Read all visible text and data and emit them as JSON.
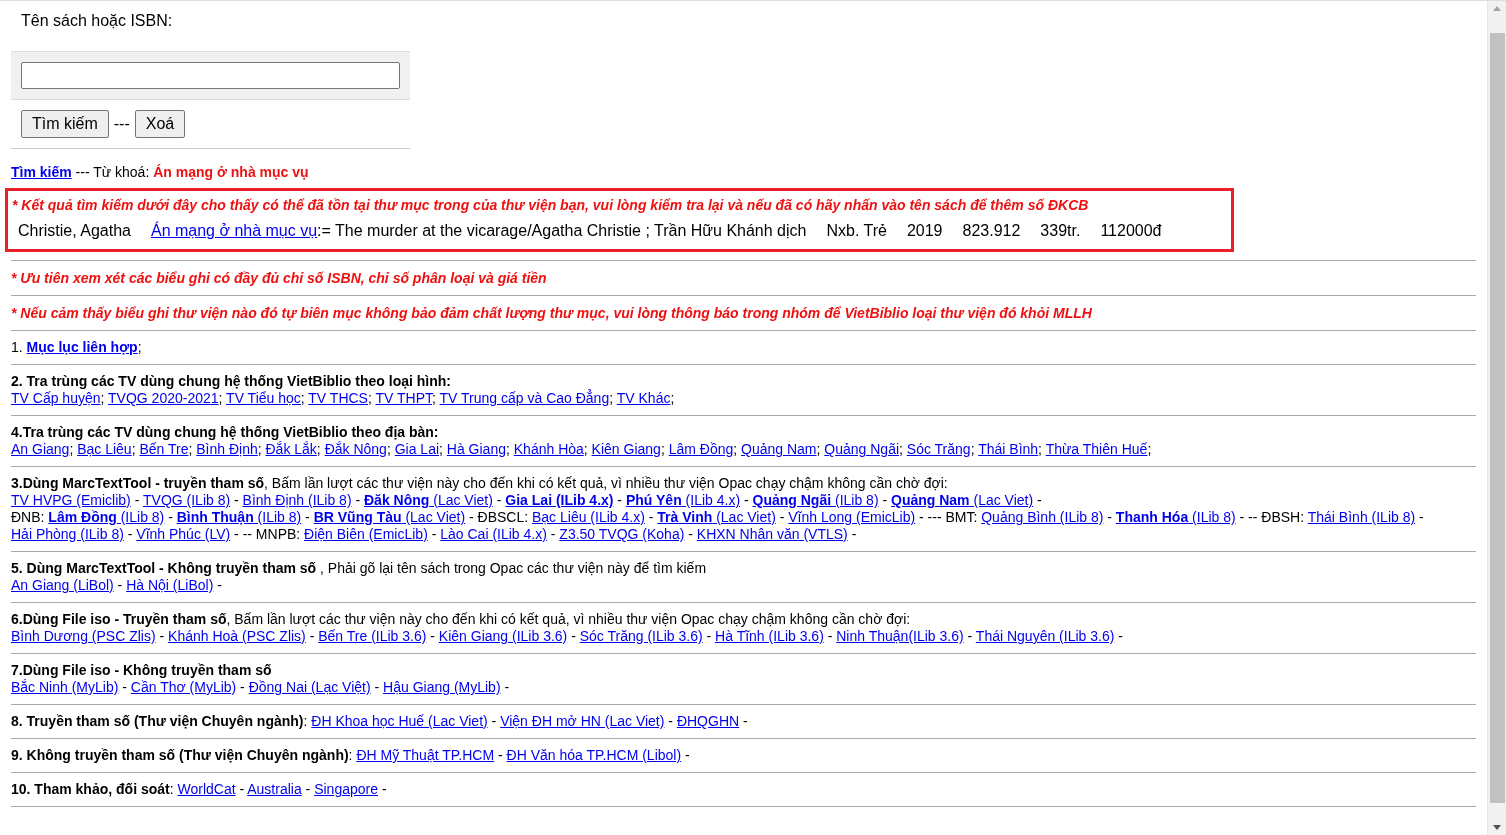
{
  "search_form": {
    "label": "Tên sách hoặc ISBN:",
    "search_button": "Tìm kiếm",
    "divider": "---",
    "clear_button": "Xoá"
  },
  "query": {
    "link": "Tìm kiếm",
    "label": " --- Từ khoá: ",
    "keyword": "Án mạng ở nhà mục vụ"
  },
  "result_box": {
    "notice": "* Kết quả tìm kiếm dưới đây cho thấy có thể đã tồn tại thư mục trong của thư viện bạn, vui lòng kiểm tra lại và nếu đã có hãy nhấn vào tên sách để thêm số ĐKCB",
    "record": {
      "author": "Christie, Agatha",
      "title_link": "Án mạng ở nhà mục vụ",
      "title_rest": ":= The murder at the vicarage/Agatha Christie ; Trần Hữu Khánh dịch",
      "publisher": "Nxb. Trẻ",
      "year": "2019",
      "class_number": "823.912",
      "pages": "339tr.",
      "price": "112000đ"
    }
  },
  "notes": [
    "* Ưu tiên xem xét các biểu ghi có đầy đủ chỉ số ISBN, chỉ số phân loại và giá tiền",
    "* Nếu cảm thấy biểu ghi thư viện nào đó tự biên mục không bảo đảm chất lượng thư mục, vui lòng thông báo trong nhóm để VietBiblio loại thư viện đó khỏi MLLH"
  ],
  "sections": [
    {
      "items": [
        {
          "kind": "text",
          "text": "1. "
        },
        {
          "kind": "link",
          "text": "**Mục lục liên hợp**",
          "after": ";"
        }
      ]
    },
    {
      "items": [
        {
          "kind": "bold",
          "text": "2. Tra trùng các TV dùng chung hệ thống VietBiblio theo loại hình:"
        },
        {
          "kind": "break"
        },
        {
          "kind": "link",
          "text": "TV Cấp huyện",
          "after": "; "
        },
        {
          "kind": "link",
          "text": "TVQG 2020-2021",
          "after": "; "
        },
        {
          "kind": "link",
          "text": "TV Tiểu học",
          "after": "; "
        },
        {
          "kind": "link",
          "text": "TV THCS",
          "after": "; "
        },
        {
          "kind": "link",
          "text": "TV THPT",
          "after": "; "
        },
        {
          "kind": "link",
          "text": "TV Trung cấp và Cao Đẳng",
          "after": "; "
        },
        {
          "kind": "link",
          "text": "TV Khác",
          "after": ";"
        }
      ]
    },
    {
      "items": [
        {
          "kind": "bold",
          "text": "4.Tra trùng các TV dùng chung hệ thống VietBiblio theo địa bàn:"
        },
        {
          "kind": "break"
        },
        {
          "kind": "link",
          "text": "An Giang",
          "after": "; "
        },
        {
          "kind": "link",
          "text": "Bạc Liêu",
          "after": "; "
        },
        {
          "kind": "link",
          "text": "Bến Tre",
          "after": "; "
        },
        {
          "kind": "link",
          "text": "Bình Định",
          "after": "; "
        },
        {
          "kind": "link",
          "text": "Đắk Lắk",
          "after": "; "
        },
        {
          "kind": "link",
          "text": "Đắk Nông",
          "after": "; "
        },
        {
          "kind": "link",
          "text": "Gia Lai",
          "after": "; "
        },
        {
          "kind": "link",
          "text": "Hà Giang",
          "after": "; "
        },
        {
          "kind": "link",
          "text": "Khánh Hòa",
          "after": "; "
        },
        {
          "kind": "link",
          "text": "Kiên Giang",
          "after": "; "
        },
        {
          "kind": "link",
          "text": "Lâm Đồng",
          "after": "; "
        },
        {
          "kind": "link",
          "text": "Quảng Nam",
          "after": "; "
        },
        {
          "kind": "link",
          "text": "Quảng Ngãi",
          "after": "; "
        },
        {
          "kind": "link",
          "text": "Sóc Trăng",
          "after": "; "
        },
        {
          "kind": "link",
          "text": "Thái Bình",
          "after": "; "
        },
        {
          "kind": "link",
          "text": "Thừa Thiên Huế",
          "after": ";"
        }
      ]
    },
    {
      "items": [
        {
          "kind": "text",
          "text": "**3.Dùng MarcTextTool - truyền tham số**, Bấm lần lượt các thư viện này cho đến khi có kết quả, vì nhiều thư viện Opac chạy chậm không cần chờ đợi:"
        },
        {
          "kind": "break"
        },
        {
          "kind": "link",
          "text": "TV HVPG (Emiclib)",
          "after": " - "
        },
        {
          "kind": "link",
          "text": "TVQG (ILib 8)",
          "after": " - "
        },
        {
          "kind": "link",
          "text": "Bình Định (ILib 8)",
          "after": " - "
        },
        {
          "kind": "link",
          "text": "**Đăk Nông** (Lac Viet)",
          "after": " - "
        },
        {
          "kind": "link",
          "text": "**Gia Lai (ILib 4.x)**",
          "after": " - "
        },
        {
          "kind": "link",
          "text": "**Phú Yên** (ILib 4.x)",
          "after": " - "
        },
        {
          "kind": "link",
          "text": "**Quảng Ngãi** (ILib 8)",
          "after": " - "
        },
        {
          "kind": "link",
          "text": "**Quảng Nam** (Lac Viet)",
          "after": " -"
        },
        {
          "kind": "break"
        },
        {
          "kind": "text",
          "text": "ĐNB: "
        },
        {
          "kind": "link",
          "text": "**Lâm Đồng** (ILib 8)",
          "after": " - "
        },
        {
          "kind": "link",
          "text": "**Bình Thuận** (ILib 8)",
          "after": " - "
        },
        {
          "kind": "link",
          "text": "**BR Vũng Tàu** (Lac Viet)",
          "after": " - ĐBSCL: "
        },
        {
          "kind": "link",
          "text": "Bạc Liêu (ILib 4.x)",
          "after": " - "
        },
        {
          "kind": "link",
          "text": "**Trà Vinh** (Lac Viet)",
          "after": " - "
        },
        {
          "kind": "link",
          "text": "Vĩnh Long (EmicLib)",
          "after": " - --- BMT: "
        },
        {
          "kind": "link",
          "text": "Quảng Bình (ILib 8)",
          "after": " - "
        },
        {
          "kind": "link",
          "text": "**Thanh Hóa** (ILib 8)",
          "after": " - -- ĐBSH: "
        },
        {
          "kind": "link",
          "text": "Thái Bình (ILib 8)",
          "after": " - "
        },
        {
          "kind": "link",
          "text": "Hải Phòng (ILib 8)",
          "after": " - "
        },
        {
          "kind": "link",
          "text": "Vĩnh Phúc (LV)",
          "after": " - -- MNPB: "
        },
        {
          "kind": "link",
          "text": "Điện Biên (EmicLib)",
          "after": " - "
        },
        {
          "kind": "link",
          "text": "Lào Cai (ILib 4.x)",
          "after": " - "
        },
        {
          "kind": "link",
          "text": "Z3.50 TVQG (Koha)",
          "after": " - "
        },
        {
          "kind": "link",
          "text": "KHXN Nhân văn (VTLS)",
          "after": " -"
        }
      ]
    },
    {
      "items": [
        {
          "kind": "text",
          "text": "**5. Dùng MarcTextTool - Không truyền tham số** , Phải gõ lại tên sách trong Opac các thư viện này để tìm kiếm"
        },
        {
          "kind": "break"
        },
        {
          "kind": "link",
          "text": "An Giang (LiBol)",
          "after": " - "
        },
        {
          "kind": "link",
          "text": "Hà Nội (LiBol)",
          "after": " -"
        }
      ]
    },
    {
      "items": [
        {
          "kind": "text",
          "text": "**6.Dùng File iso - Truyền tham số**, Bấm lần lượt các thư viện này cho đến khi có kết quả, vì nhiều thư viện Opac chạy chậm không cần chờ đợi:"
        },
        {
          "kind": "break"
        },
        {
          "kind": "link",
          "text": "Bình Dương (PSC Zlis)",
          "after": " - "
        },
        {
          "kind": "link",
          "text": "Khánh Hoà (PSC Zlis)",
          "after": " - "
        },
        {
          "kind": "link",
          "text": "Bến Tre (ILib 3.6)",
          "after": " - "
        },
        {
          "kind": "link",
          "text": "Kiên Giang (ILib 3.6)",
          "after": " - "
        },
        {
          "kind": "link",
          "text": "Sóc Trăng (ILib 3.6)",
          "after": " - "
        },
        {
          "kind": "link",
          "text": "Hà Tĩnh (ILib 3.6)",
          "after": " - "
        },
        {
          "kind": "link",
          "text": "Ninh Thuận(ILib 3.6)",
          "after": " - "
        },
        {
          "kind": "link",
          "text": "Thái Nguyên (ILib 3.6)",
          "after": " -"
        }
      ]
    },
    {
      "items": [
        {
          "kind": "bold",
          "text": "7.Dùng File iso - Không truyền tham số"
        },
        {
          "kind": "break"
        },
        {
          "kind": "link",
          "text": "Bắc Ninh (MyLib)",
          "after": " - "
        },
        {
          "kind": "link",
          "text": "Cần Thơ (MyLib)",
          "after": " - "
        },
        {
          "kind": "link",
          "text": "Đồng Nai (Lạc Việt)",
          "after": " - "
        },
        {
          "kind": "link",
          "text": "Hậu Giang (MyLib)",
          "after": " -"
        }
      ]
    },
    {
      "items": [
        {
          "kind": "text",
          "text": "**8. Truyền tham số (Thư viện Chuyên ngành)**: "
        },
        {
          "kind": "link",
          "text": "ĐH Khoa học Huế (Lac Viet)",
          "after": " - "
        },
        {
          "kind": "link",
          "text": "Viện ĐH mở HN (Lac Viet)",
          "after": " - "
        },
        {
          "kind": "link",
          "text": "ĐHQGHN",
          "after": " -"
        }
      ]
    },
    {
      "items": [
        {
          "kind": "text",
          "text": "**9. Không truyền tham số (Thư viện Chuyên ngành)**: "
        },
        {
          "kind": "link",
          "text": "ĐH Mỹ Thuật TP.HCM",
          "after": " - "
        },
        {
          "kind": "link",
          "text": "ĐH Văn hóa TP.HCM (Libol)",
          "after": " -"
        }
      ]
    },
    {
      "items": [
        {
          "kind": "text",
          "text": "**10. Tham khảo, đối soát**: "
        },
        {
          "kind": "link",
          "text": "WorldCat",
          "after": " - "
        },
        {
          "kind": "link",
          "text": "Australia",
          "after": " - "
        },
        {
          "kind": "link",
          "text": "Singapore",
          "after": " -"
        }
      ]
    }
  ]
}
